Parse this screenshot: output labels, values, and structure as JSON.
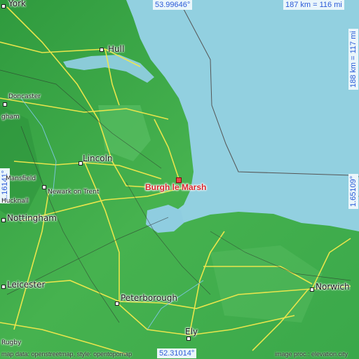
{
  "place": {
    "name": "Burgh le Marsh",
    "marker_color": "#e8434a"
  },
  "coordinates": {
    "lat_top": "53.99646°",
    "lat_bottom": "52.31014°",
    "lon_left": "1.16141°",
    "lon_right": "1.65109°"
  },
  "scale": {
    "horizontal": "187 km = 116 mi",
    "vertical": "188 km = 117 mi"
  },
  "cities": {
    "york": "York",
    "hull": "Hull",
    "doncaster": "Doncaster",
    "lincoln": "Lincoln",
    "newark": "Newark on Trent",
    "nottingham": "Nottingham",
    "leicester": "Leicester",
    "peterborough": "Peterborough",
    "ely": "Ely",
    "norwich": "Norwich",
    "hucknall": "Hucknall",
    "mansfield": "Mansfield",
    "rugby": "Rugby",
    "gham": "gham"
  },
  "footer": {
    "left": "map data: openstreetmap, style: opentopomap",
    "right": "image proc.: elevation.city"
  },
  "colors": {
    "sea": "#92d0e0",
    "land": "#3aa84a",
    "coordinate_text": "#2a5ad8",
    "road": "#f2e84c"
  }
}
